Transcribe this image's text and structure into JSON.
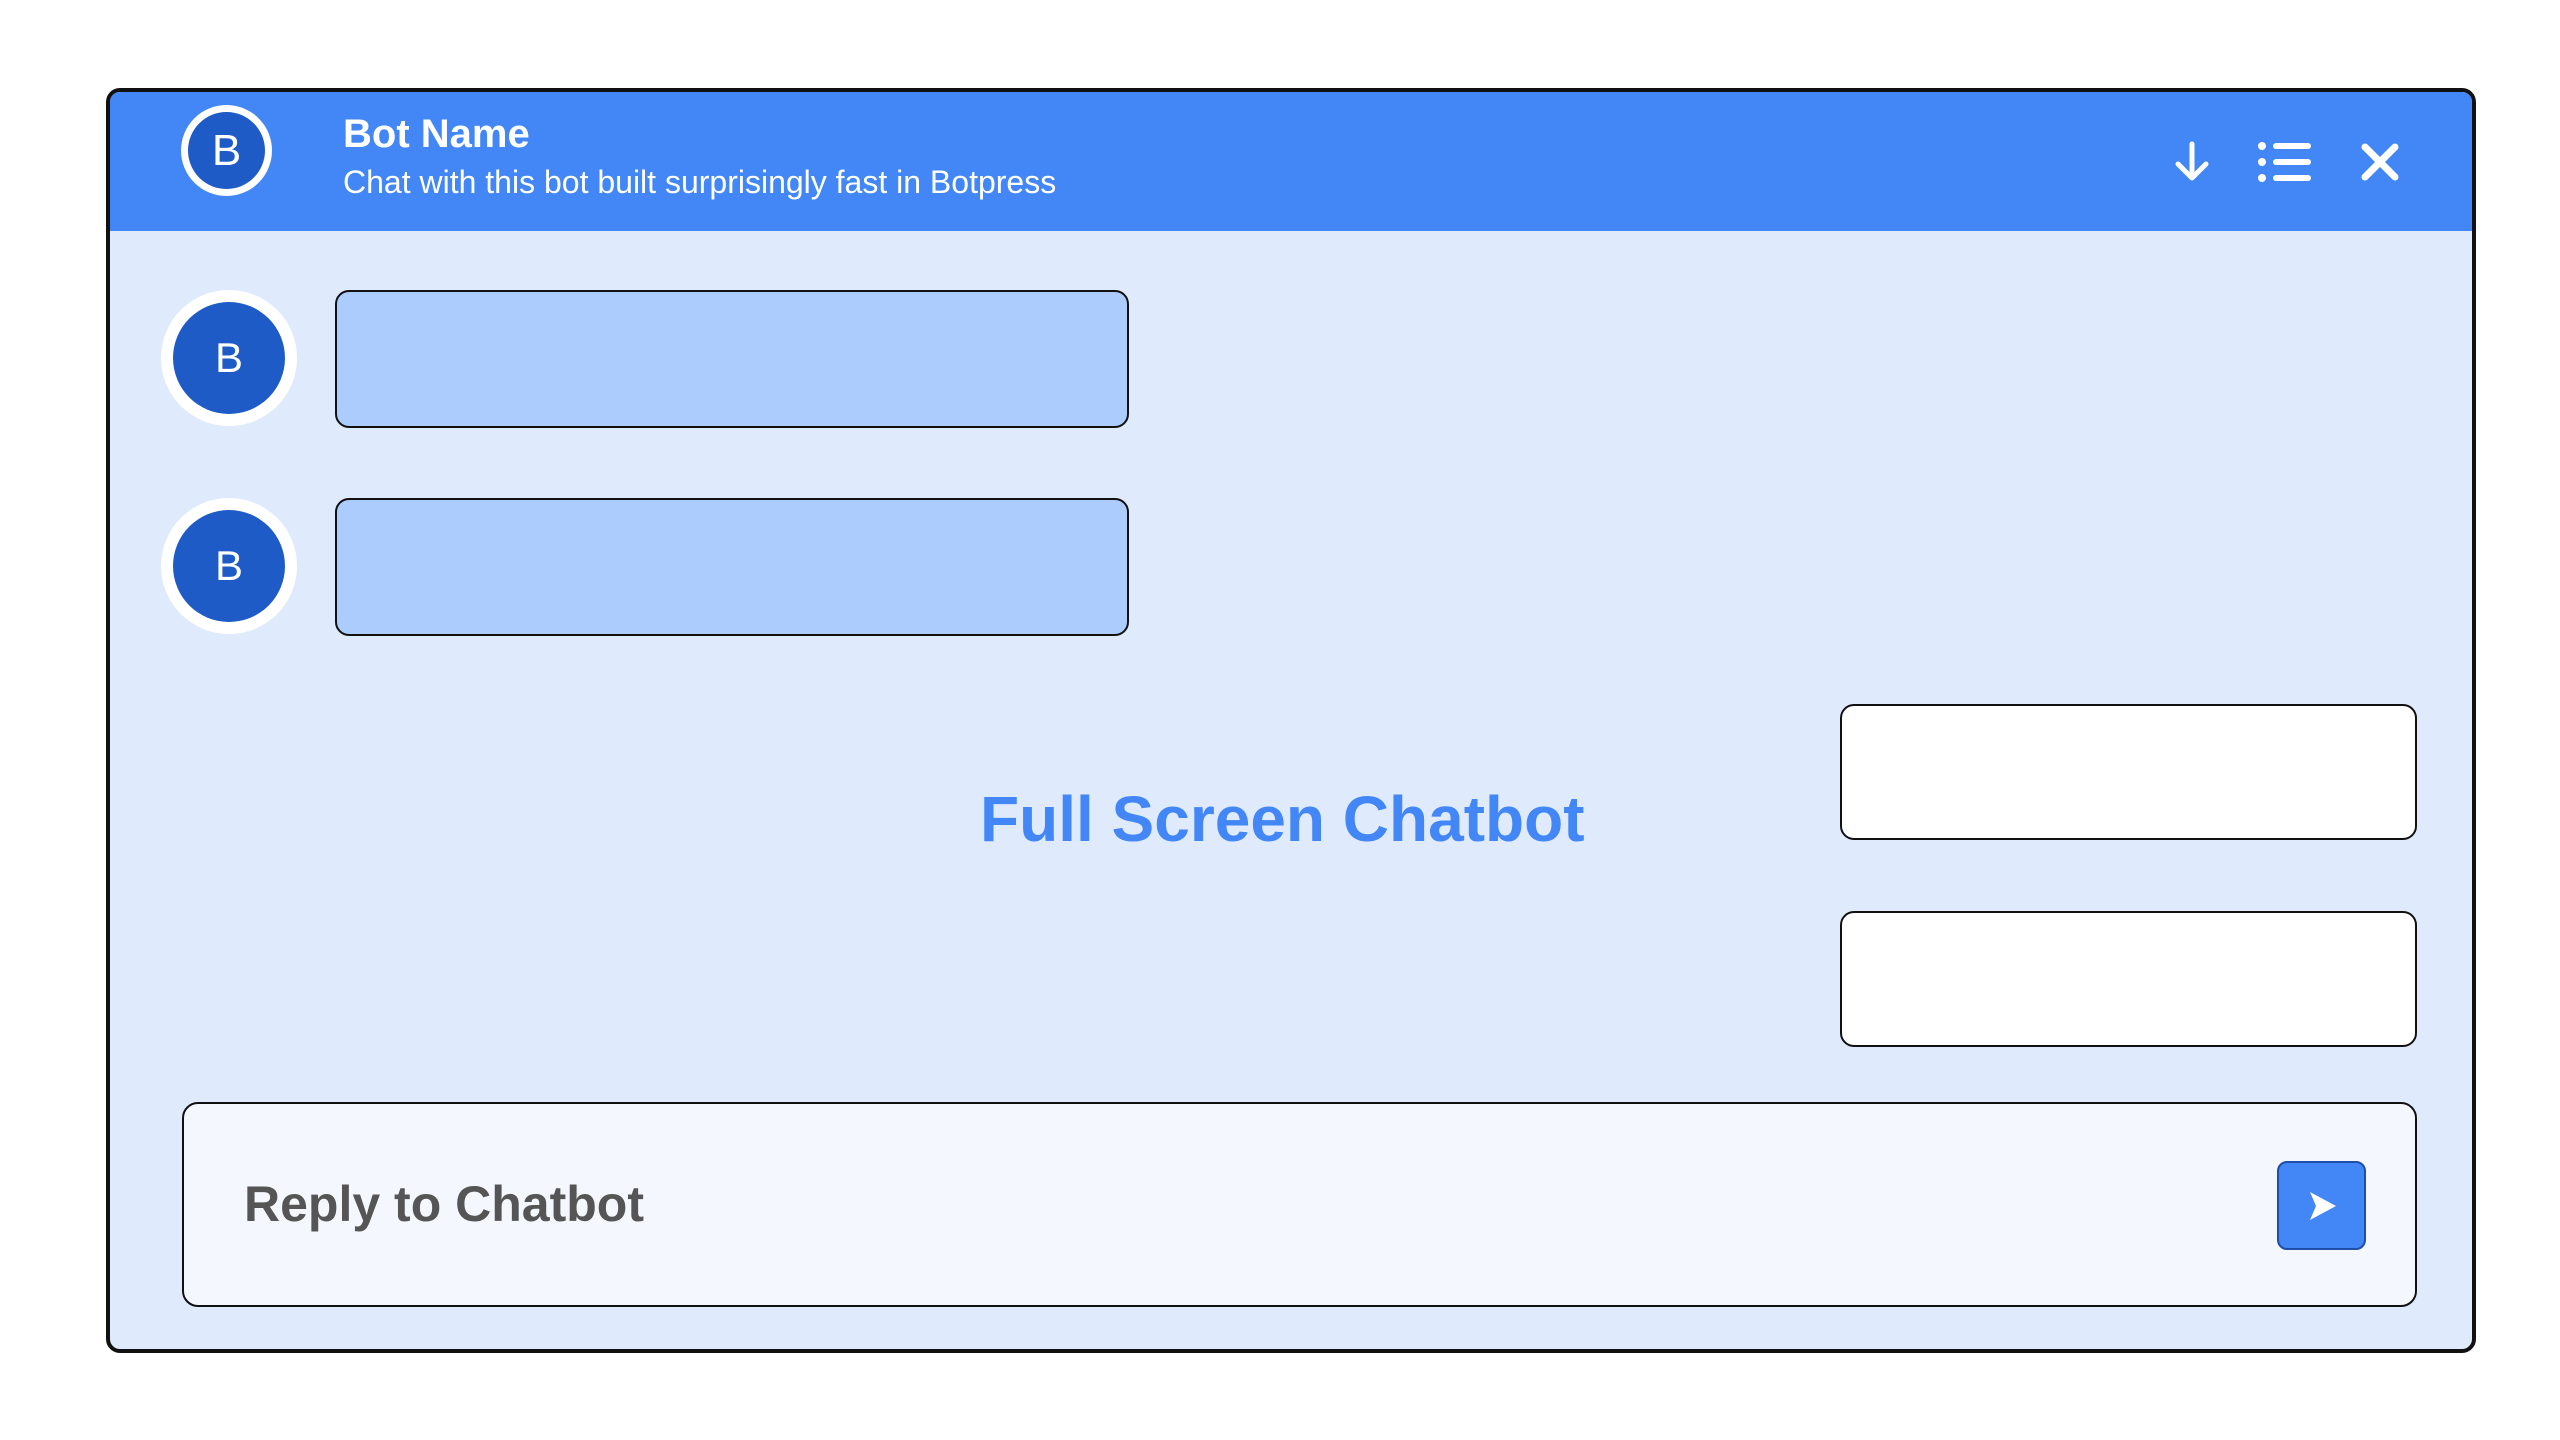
{
  "header": {
    "avatar_letter": "B",
    "bot_name": "Bot Name",
    "subtitle": "Chat with this bot built surprisingly fast in Botpress",
    "icons": [
      "download-icon",
      "list-icon",
      "close-icon"
    ]
  },
  "messages": {
    "bot": [
      {
        "avatar_letter": "B",
        "text": ""
      },
      {
        "avatar_letter": "B",
        "text": ""
      }
    ],
    "user": [
      {
        "text": ""
      },
      {
        "text": ""
      }
    ]
  },
  "center_title": "Full Screen Chatbot",
  "composer": {
    "placeholder": "Reply to Chatbot",
    "value": "",
    "send_icon": "send-icon"
  },
  "colors": {
    "header": "#4287f5",
    "background": "#dfebfd",
    "bot_bubble": "#abccfc",
    "user_bubble": "#ffffff",
    "avatar": "#1e5bc6",
    "title": "#4287f5"
  }
}
